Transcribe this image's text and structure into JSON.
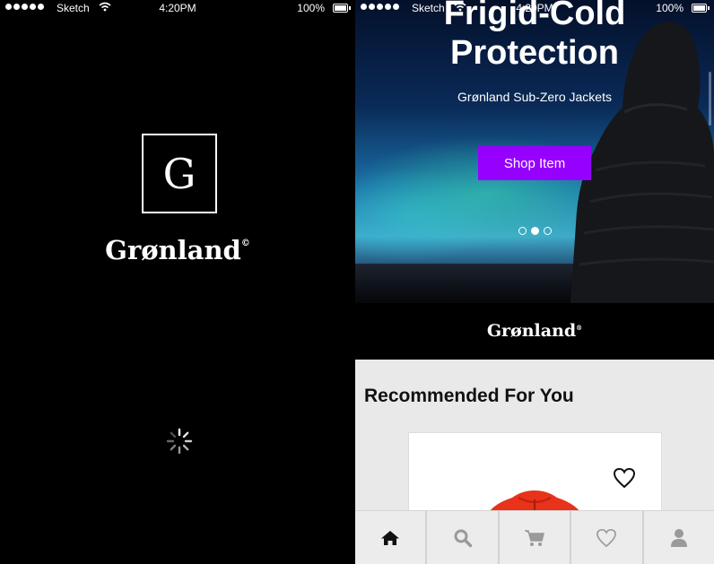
{
  "status_bar": {
    "carrier": "Sketch",
    "time": "4:20PM",
    "battery": "100%"
  },
  "splash": {
    "logo_letter": "G",
    "brand_name": "Grønland",
    "brand_mark": "©"
  },
  "home": {
    "hero": {
      "title_line1": "Frigid-Cold",
      "title_line2": "Protection",
      "subtitle": "Grønland Sub-Zero Jackets",
      "button_label": "Shop Item",
      "button_color": "#9500ff",
      "pager": {
        "count": 3,
        "active": 2
      }
    },
    "brand_name": "Grønland",
    "brand_mark": "®",
    "recommended_title": "Recommended For You",
    "product_card": {
      "favorite_icon": "heart-icon",
      "product_color": "#e8321a"
    },
    "tabs": [
      {
        "name": "home",
        "icon": "home-icon",
        "active": true
      },
      {
        "name": "search",
        "icon": "search-icon"
      },
      {
        "name": "cart",
        "icon": "cart-icon"
      },
      {
        "name": "favorites",
        "icon": "heart-icon"
      },
      {
        "name": "profile",
        "icon": "user-icon"
      }
    ]
  }
}
